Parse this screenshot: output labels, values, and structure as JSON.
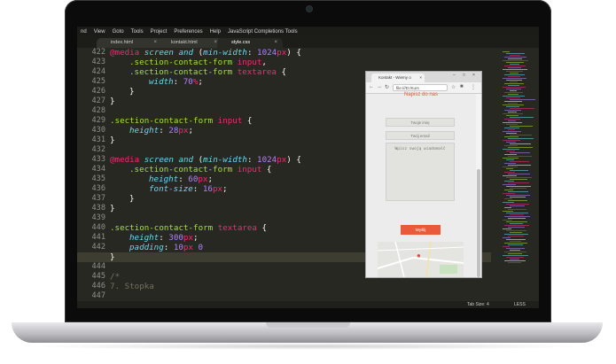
{
  "menu": [
    "nd",
    "View",
    "Goto",
    "Tools",
    "Project",
    "Preferences",
    "Help",
    "JavaScript Completions Tools"
  ],
  "tabs": [
    {
      "label": "index.html",
      "close": "×"
    },
    {
      "label": "kontakt.html",
      "close": "×"
    },
    {
      "label": "style.css",
      "close": "×"
    }
  ],
  "line_numbers": [
    "422",
    "423",
    "424",
    "425",
    "426",
    "427",
    "428",
    "429",
    "430",
    "431",
    "432",
    "433",
    "434",
    "435",
    "436",
    "437",
    "438",
    "439",
    "440",
    "441",
    "442",
    "443",
    "444",
    "445",
    "446",
    "447"
  ],
  "highlighted_line": "443",
  "code": {
    "l422": {
      "at": "@media",
      "sp1": " ",
      "s1": "screen",
      "and": " and ",
      "open": "(",
      "mf": "min-width",
      "col": ": ",
      "num": "1024",
      "unit": "px",
      "close": ")",
      "br": " {"
    },
    "l423": {
      "sel": ".section-contact-form",
      "tag": " input",
      "comma": ","
    },
    "l424": {
      "sel": ".section-contact-form",
      "tag": " textarea",
      "br": " {"
    },
    "l425": {
      "prop": "width",
      "col": ": ",
      "num": "70",
      "unit": "%",
      "semi": ";"
    },
    "l426": {
      "t": "}"
    },
    "l427": {
      "t": "}"
    },
    "l428": {
      "t": ""
    },
    "l429": {
      "sel": ".section-contact-form",
      "tag": " input",
      "br": " {"
    },
    "l430": {
      "prop": "height",
      "col": ": ",
      "num": "28",
      "unit": "px",
      "semi": ";"
    },
    "l431": {
      "t": "}"
    },
    "l432": {
      "t": ""
    },
    "l433": {
      "at": "@media",
      "sp1": " ",
      "s1": "screen",
      "and": " and ",
      "open": "(",
      "mf": "min-width",
      "col": ": ",
      "num": "1024",
      "unit": "px",
      "close": ")",
      "br": " {"
    },
    "l434": {
      "sel": ".section-contact-form",
      "tag": " input",
      "br": " {"
    },
    "l435": {
      "prop": "height",
      "col": ": ",
      "num": "60",
      "unit": "px",
      "semi": ";"
    },
    "l436": {
      "prop": "font-size",
      "col": ": ",
      "num": "16",
      "unit": "px",
      "semi": ";"
    },
    "l437": {
      "t": "}"
    },
    "l438": {
      "t": "}"
    },
    "l439": {
      "t": ""
    },
    "l440": {
      "sel": ".section-contact-form",
      "tag": " textarea",
      "br": " {"
    },
    "l441": {
      "prop": "height",
      "col": ": ",
      "num": "300",
      "unit": "px",
      "semi": ";"
    },
    "l442": {
      "prop": "padding",
      "col": ": ",
      "num": "10",
      "unit": "px",
      "rest": " 0"
    },
    "l443": {
      "t": "}"
    },
    "l444": {
      "t": ""
    },
    "l445": {
      "t": "/*"
    },
    "l446": {
      "t": "7. Stopka"
    },
    "l447": {
      "t": ""
    }
  },
  "status": {
    "tab_size": "Tab Size: 4",
    "syntax": "LESS"
  },
  "browser": {
    "tab_title": "Kontakt - Wiemy o",
    "tab_close": "×",
    "win_min": "−",
    "win_max": "□",
    "win_close": "×",
    "url": "file:///D:/Kurs",
    "heading": "Napisz do nas",
    "name_placeholder": "Twoje imię",
    "email_placeholder": "Twój email",
    "message_placeholder": "Wpisz swoją wiadomość",
    "send_label": "Wyślij"
  },
  "colors": {
    "editor_bg": "#272822",
    "accent": "#e85a3a",
    "keyword": "#f92672",
    "number": "#ae81ff",
    "property": "#66d9ef",
    "selector": "#a6e22e"
  }
}
